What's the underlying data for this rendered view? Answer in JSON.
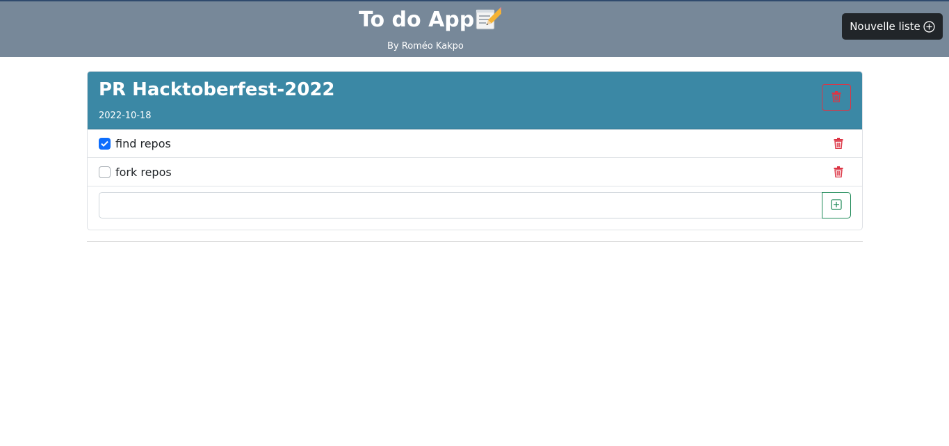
{
  "header": {
    "title": "To do App",
    "subtitle": "By Roméo Kakpo",
    "new_list_label": "Nouvelle liste",
    "background": "#778899"
  },
  "list": {
    "title": "PR Hacktoberfest-2022",
    "date": "2022-10-18",
    "header_color": "#3b88a5",
    "tasks": [
      {
        "label": "find repos",
        "done": true
      },
      {
        "label": "fork repos",
        "done": false
      }
    ],
    "new_task": {
      "value": "",
      "placeholder": ""
    }
  },
  "icons": {
    "app": "memo-icon",
    "new_list": "plus-circle-icon",
    "delete": "trash-icon",
    "add": "plus-square-icon"
  },
  "colors": {
    "danger": "#dc3545",
    "success": "#198754",
    "checkbox_checked": "#0d6efd",
    "button_dark": "#212529"
  }
}
